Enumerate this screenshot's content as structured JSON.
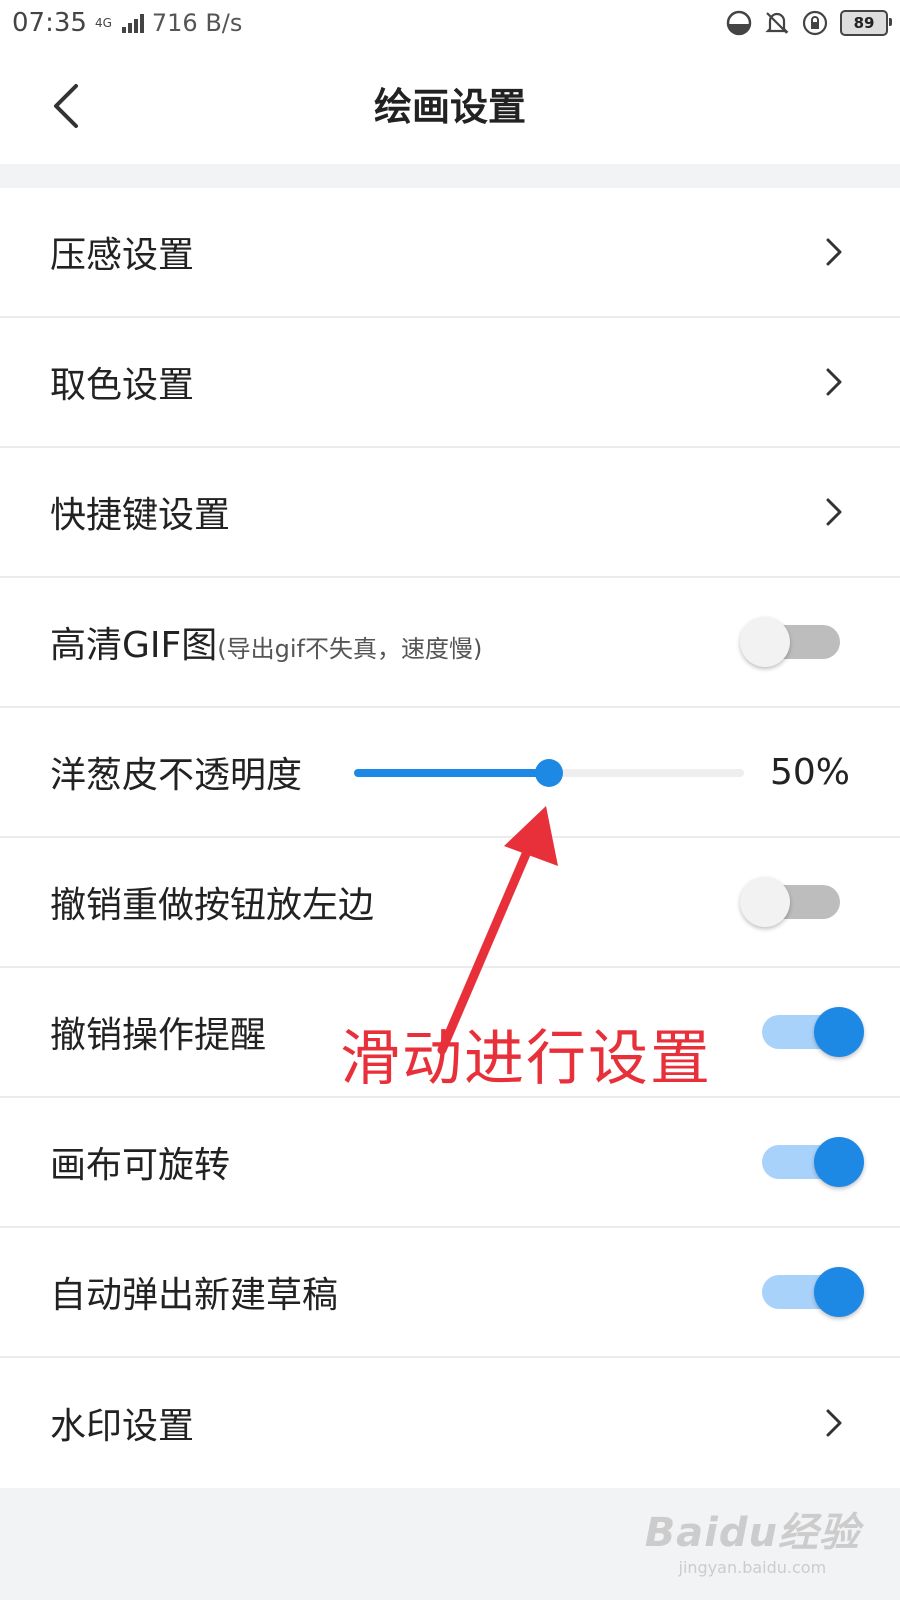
{
  "status_bar": {
    "time": "07:35",
    "network": "4G",
    "speed": "716 B/s",
    "battery": "89"
  },
  "header": {
    "title": "绘画设置"
  },
  "settings": {
    "pressure": "压感设置",
    "color_pick": "取色设置",
    "shortcuts": "快捷键设置",
    "hd_gif": "高清GIF图",
    "hd_gif_sub": "(导出gif不失真，速度慢)",
    "hd_gif_on": false,
    "onion_opacity": "洋葱皮不透明度",
    "onion_opacity_value": 0.5,
    "onion_opacity_text": "50%",
    "undo_left": "撤销重做按钮放左边",
    "undo_left_on": false,
    "undo_reminder": "撤销操作提醒",
    "undo_reminder_on": true,
    "canvas_rotate": "画布可旋转",
    "canvas_rotate_on": true,
    "auto_new_draft": "自动弹出新建草稿",
    "auto_new_draft_on": true,
    "watermark": "水印设置"
  },
  "annotation": {
    "text": "滑动进行设置",
    "color": "#e8303a"
  },
  "watermark_logo": {
    "brand": "Baidu经验",
    "url": "jingyan.baidu.com"
  },
  "colors": {
    "accent": "#1e88e5",
    "switch_track_on": "#a9d2fb",
    "switch_track_off": "#bdbdbd"
  }
}
